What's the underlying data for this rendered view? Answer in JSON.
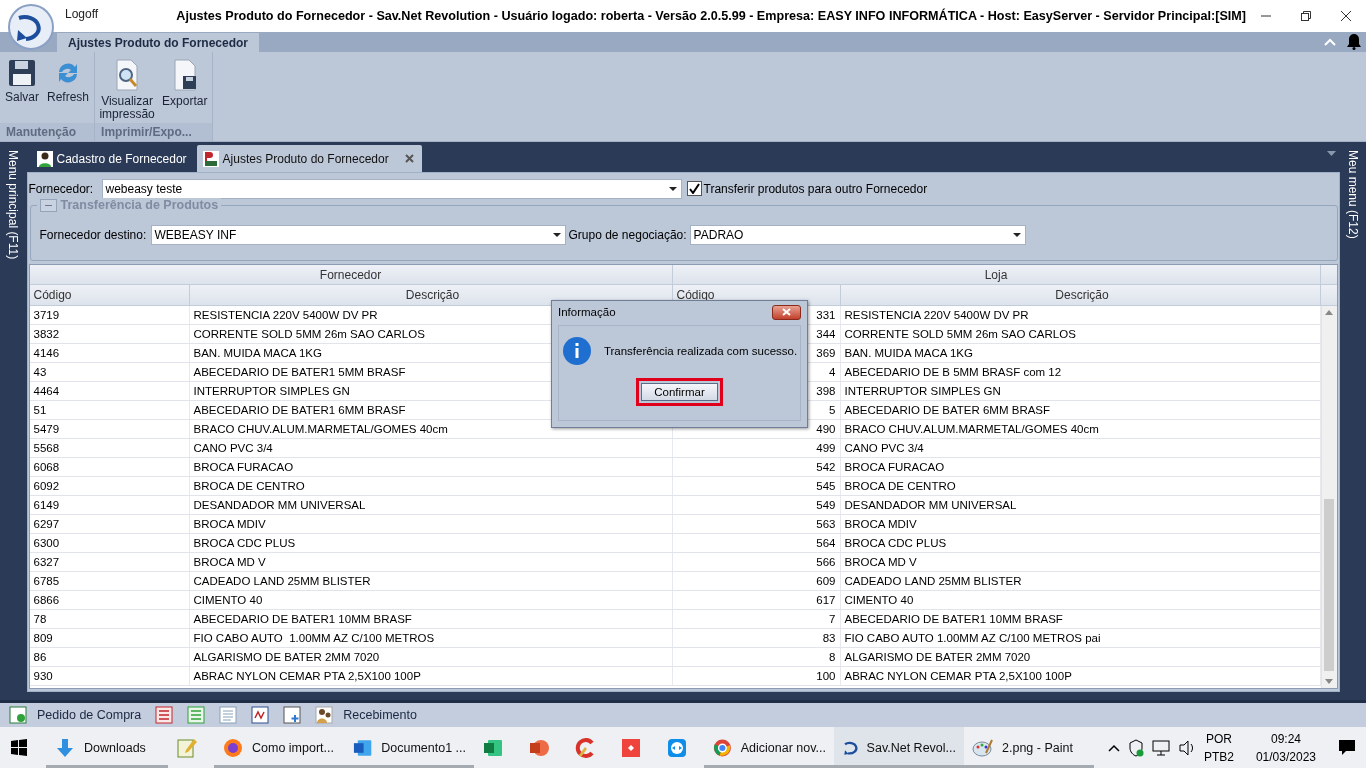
{
  "app": {
    "logoff": "Logoff",
    "title": "Ajustes Produto do Fornecedor - Sav.Net Revolution - Usuário logado: roberta - Versão 2.0.5.99 - Empresa: EASY INFO INFORMÁTICA - Host: EasyServer - Servidor Principal:[SIM]"
  },
  "ribbon": {
    "tabs": [
      {
        "label": "Ajustes Produto do Fornecedor",
        "selected": true
      }
    ],
    "groups": [
      {
        "label": "Manutenção",
        "buttons": [
          {
            "label": "Salvar",
            "kind": "save"
          },
          {
            "label": "Refresh",
            "kind": "refresh"
          }
        ]
      },
      {
        "label": "Imprimir/Expo...",
        "buttons": [
          {
            "label": "Visualizar impressão",
            "kind": "preview"
          },
          {
            "label": "Exportar",
            "kind": "export"
          }
        ]
      }
    ]
  },
  "side_left": "Menu principal (F11)",
  "side_right": "Meu menu (F12)",
  "doc_tabs": [
    {
      "label": "Cadastro de Fornecedor",
      "selected": false,
      "kind": "person"
    },
    {
      "label": "Ajustes Produto do Fornecedor",
      "selected": true,
      "kind": "product"
    }
  ],
  "form": {
    "fornecedor_label": "Fornecedor:",
    "fornecedor_value": "webeasy teste",
    "transfer": {
      "label": "Transferir produtos para outro Fornecedor",
      "checked": true
    },
    "group": {
      "title": "Transferência de Produtos",
      "expanded": true,
      "destino_label": "Fornecedor destino:",
      "destino_value": "WEBEASY INF",
      "grupo_label": "Grupo de negociação:",
      "grupo_value": "PADRAO"
    }
  },
  "grid": {
    "bands": [
      "Fornecedor",
      "Loja"
    ],
    "columns": [
      "Código",
      "Descrição",
      "Código",
      "Descrição"
    ],
    "rows": [
      [
        "3719",
        "RESISTENCIA 220V 5400W DV PR",
        "331",
        "RESISTENCIA 220V 5400W DV PR"
      ],
      [
        "3832",
        "CORRENTE SOLD 5MM 26m SAO CARLOS",
        "344",
        "CORRENTE SOLD 5MM 26m SAO CARLOS"
      ],
      [
        "4146",
        "BAN. MUIDA MACA 1KG",
        "369",
        "BAN. MUIDA MACA 1KG"
      ],
      [
        "43",
        "ABECEDARIO DE BATER1 5MM BRASF",
        "4",
        "ABECEDARIO DE B 5MM BRASF com 12"
      ],
      [
        "4464",
        "INTERRUPTOR SIMPLES GN",
        "398",
        "INTERRUPTOR SIMPLES GN"
      ],
      [
        "51",
        "ABECEDARIO DE BATER1 6MM BRASF",
        "5",
        "ABECEDARIO DE BATER 6MM BRASF"
      ],
      [
        "5479",
        "BRACO CHUV.ALUM.MARMETAL/GOMES 40cm",
        "490",
        "BRACO CHUV.ALUM.MARMETAL/GOMES 40cm"
      ],
      [
        "5568",
        "CANO PVC 3/4",
        "499",
        "CANO PVC 3/4"
      ],
      [
        "6068",
        "BROCA FURACAO",
        "542",
        "BROCA FURACAO"
      ],
      [
        "6092",
        "BROCA DE CENTRO",
        "545",
        "BROCA DE CENTRO"
      ],
      [
        "6149",
        "DESANDADOR MM UNIVERSAL",
        "549",
        "DESANDADOR MM UNIVERSAL"
      ],
      [
        "6297",
        "BROCA MDIV",
        "563",
        "BROCA MDIV"
      ],
      [
        "6300",
        "BROCA CDC PLUS",
        "564",
        "BROCA CDC PLUS"
      ],
      [
        "6327",
        "BROCA MD V",
        "566",
        "BROCA MD V"
      ],
      [
        "6785",
        "CADEADO LAND 25MM BLISTER",
        "609",
        "CADEADO LAND 25MM BLISTER"
      ],
      [
        "6866",
        "CIMENTO 40",
        "617",
        "CIMENTO 40"
      ],
      [
        "78",
        "ABECEDARIO DE BATER1 10MM BRASF",
        "7",
        "ABECEDARIO DE BATER1 10MM BRASF"
      ],
      [
        "809",
        "FIO CABO AUTO  1.00MM AZ C/100 METROS",
        "83",
        "FIO CABO AUTO 1.00MM AZ C/100 METROS pai"
      ],
      [
        "86",
        "ALGARISMO DE BATER 2MM 7020",
        "8",
        "ALGARISMO DE BATER 2MM 7020"
      ],
      [
        "930",
        "ABRAC NYLON CEMAR PTA 2,5X100 100P",
        "100",
        "ABRAC NYLON CEMAR PTA 2,5X100 100P"
      ]
    ]
  },
  "dialog": {
    "title": "Informação",
    "message": "Transferência realizada com sucesso.",
    "button": "Confirmar",
    "highlighted": true
  },
  "bottom_toolbar": [
    {
      "kind": "order",
      "label": "Pedido de Compra"
    },
    {
      "kind": "red-list"
    },
    {
      "kind": "green-list"
    },
    {
      "kind": "document"
    },
    {
      "kind": "nfe"
    },
    {
      "kind": "add-product"
    },
    {
      "kind": "people",
      "label": "Recebimento"
    }
  ],
  "taskbar": {
    "items": [
      {
        "kind": "windows",
        "running": false,
        "selected": false
      },
      {
        "kind": "download",
        "label": "Downloads",
        "running": true,
        "selected": false
      },
      {
        "kind": "notepad",
        "running": false,
        "selected": false
      },
      {
        "kind": "firefox",
        "label": "Como import...",
        "running": true,
        "selected": false
      },
      {
        "kind": "word",
        "label": "Documento1 ...",
        "running": true,
        "selected": false
      },
      {
        "kind": "excel",
        "running": false,
        "selected": false
      },
      {
        "kind": "powerpoint",
        "running": false,
        "selected": false
      },
      {
        "kind": "cleaner",
        "running": false,
        "selected": false
      },
      {
        "kind": "remote",
        "running": false,
        "selected": false
      },
      {
        "kind": "teamviewer",
        "running": false,
        "selected": false
      },
      {
        "kind": "chrome",
        "label": "Adicionar nov...",
        "running": true,
        "selected": false
      },
      {
        "kind": "savnet",
        "label": "Sav.Net Revol...",
        "running": true,
        "selected": true
      },
      {
        "kind": "paint",
        "label": "2.png - Paint",
        "running": true,
        "selected": false
      }
    ],
    "lang": [
      "POR",
      "PTB2"
    ],
    "time": "09:24",
    "date": "01/03/2023"
  }
}
